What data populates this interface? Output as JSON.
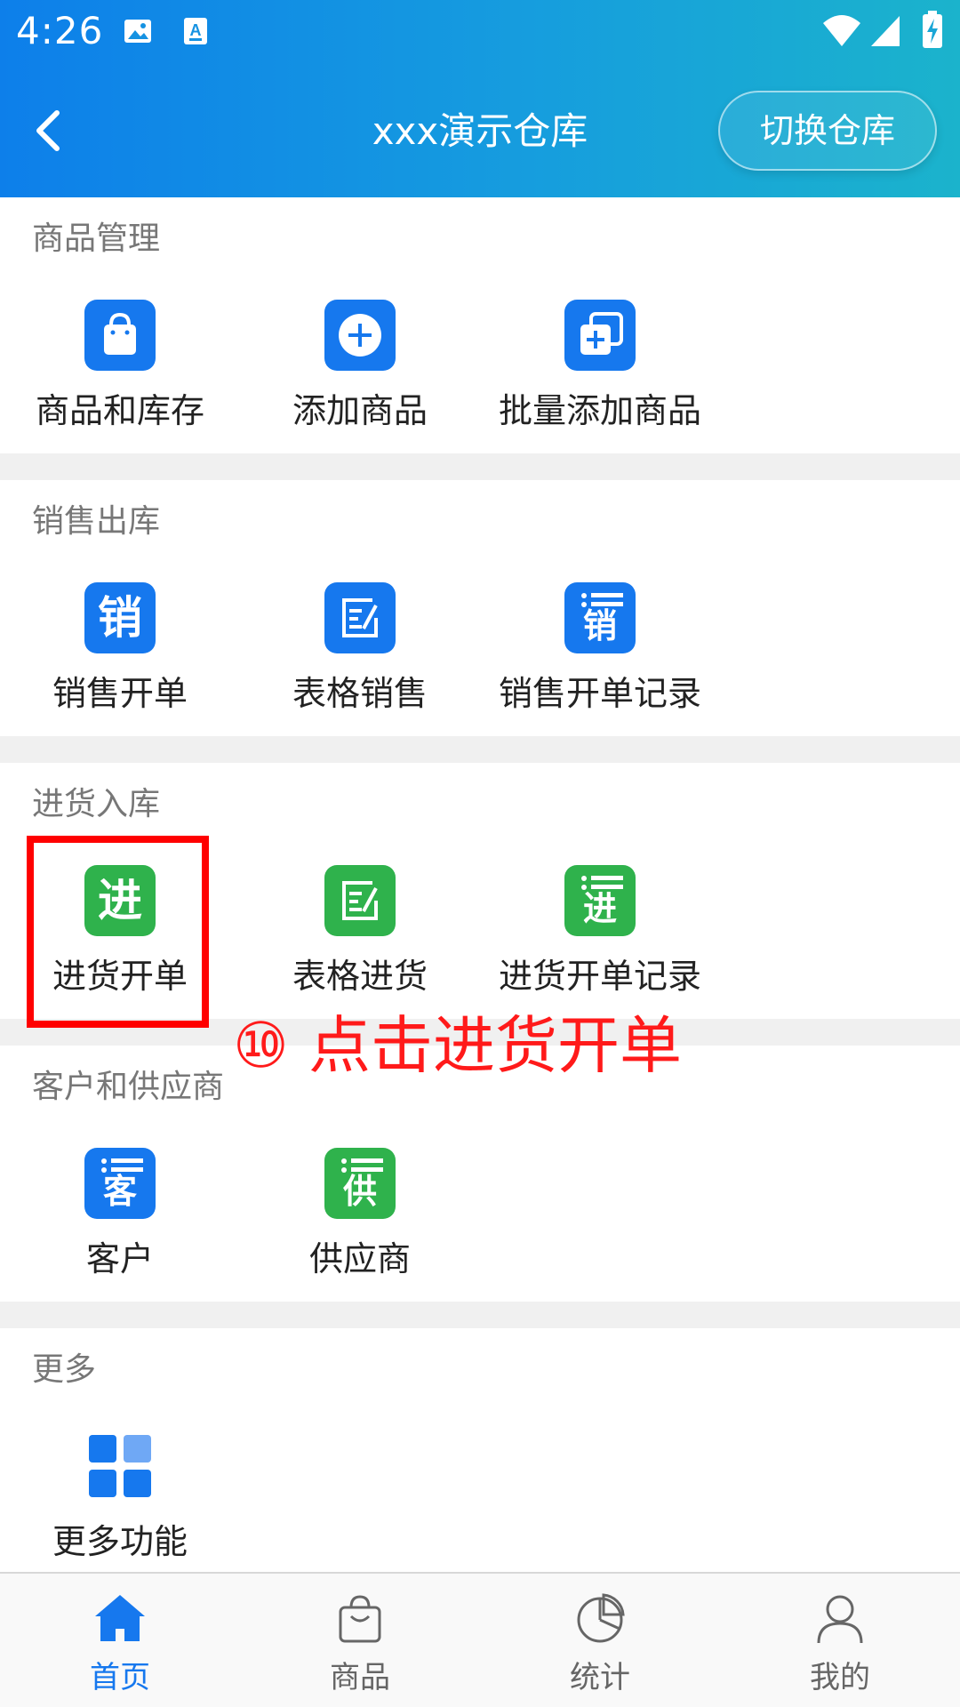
{
  "status_bar": {
    "time": "4:26"
  },
  "navbar": {
    "title": "xxx演示仓库",
    "switch_label": "切换仓库"
  },
  "sections": [
    {
      "title": "商品管理",
      "items": [
        {
          "label": "商品和库存",
          "icon": "shopping-bag-icon",
          "color": "#1678ee"
        },
        {
          "label": "添加商品",
          "icon": "plus-circle-icon",
          "color": "#1678ee"
        },
        {
          "label": "批量添加商品",
          "icon": "batch-add-icon",
          "color": "#1678ee"
        }
      ]
    },
    {
      "title": "销售出库",
      "items": [
        {
          "label": "销售开单",
          "icon": "sale-order-icon",
          "glyph": "销",
          "color": "#1678ee"
        },
        {
          "label": "表格销售",
          "icon": "table-edit-icon",
          "color": "#1678ee"
        },
        {
          "label": "销售开单记录",
          "icon": "sale-records-icon",
          "glyph": "销",
          "color": "#1678ee"
        }
      ]
    },
    {
      "title": "进货入库",
      "items": [
        {
          "label": "进货开单",
          "icon": "purchase-order-icon",
          "glyph": "进",
          "color": "#2fb24c"
        },
        {
          "label": "表格进货",
          "icon": "table-edit-icon",
          "color": "#2fb24c"
        },
        {
          "label": "进货开单记录",
          "icon": "purchase-records-icon",
          "glyph": "进",
          "color": "#2fb24c"
        }
      ]
    },
    {
      "title": "客户和供应商",
      "items": [
        {
          "label": "客户",
          "icon": "customer-list-icon",
          "glyph": "客",
          "color": "#1678ee"
        },
        {
          "label": "供应商",
          "icon": "supplier-list-icon",
          "glyph": "供",
          "color": "#2fb24c"
        }
      ]
    },
    {
      "title": "更多",
      "items": [
        {
          "label": "更多功能",
          "icon": "grid-icon",
          "color": "#1678ee"
        }
      ]
    }
  ],
  "annotation": {
    "text": "⑩ 点击进货开单",
    "color": "#ff1a1a"
  },
  "tabbar": [
    {
      "label": "首页",
      "icon": "home-icon",
      "active": true
    },
    {
      "label": "商品",
      "icon": "shopping-bag-icon",
      "active": false
    },
    {
      "label": "统计",
      "icon": "pie-chart-icon",
      "active": false
    },
    {
      "label": "我的",
      "icon": "user-icon",
      "active": false
    }
  ],
  "colors": {
    "accent": "#1678ee",
    "green": "#2fb24c",
    "header_start": "#0d7fea",
    "header_end": "#1bb3cc"
  }
}
